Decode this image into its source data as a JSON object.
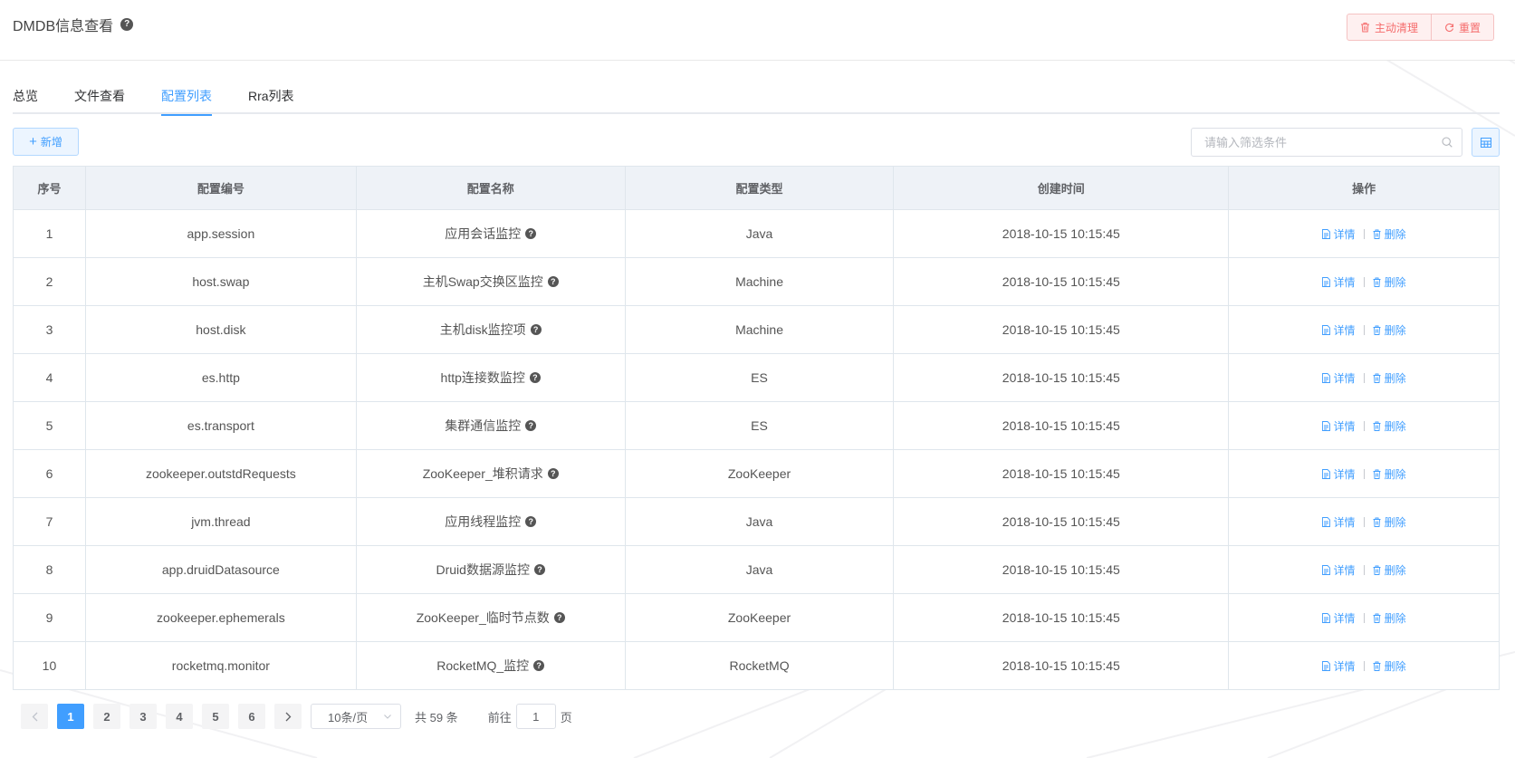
{
  "header": {
    "title": "DMDB信息查看",
    "clear_label": "主动清理",
    "reset_label": "重置"
  },
  "tabs": [
    {
      "label": "总览"
    },
    {
      "label": "文件查看"
    },
    {
      "label": "配置列表",
      "active": true
    },
    {
      "label": "Rra列表"
    }
  ],
  "toolbar": {
    "add_label": "新增",
    "search_placeholder": "请输入筛选条件"
  },
  "table": {
    "headers": [
      "序号",
      "配置编号",
      "配置名称",
      "配置类型",
      "创建时间",
      "操作"
    ],
    "rows": [
      {
        "idx": "1",
        "code": "app.session",
        "name": "应用会话监控",
        "type": "Java",
        "created": "2018-10-15 10:15:45"
      },
      {
        "idx": "2",
        "code": "host.swap",
        "name": "主机Swap交换区监控",
        "type": "Machine",
        "created": "2018-10-15 10:15:45"
      },
      {
        "idx": "3",
        "code": "host.disk",
        "name": "主机disk监控项",
        "type": "Machine",
        "created": "2018-10-15 10:15:45"
      },
      {
        "idx": "4",
        "code": "es.http",
        "name": "http连接数监控",
        "type": "ES",
        "created": "2018-10-15 10:15:45"
      },
      {
        "idx": "5",
        "code": "es.transport",
        "name": "集群通信监控",
        "type": "ES",
        "created": "2018-10-15 10:15:45"
      },
      {
        "idx": "6",
        "code": "zookeeper.outstdRequests",
        "name": "ZooKeeper_堆积请求",
        "type": "ZooKeeper",
        "created": "2018-10-15 10:15:45"
      },
      {
        "idx": "7",
        "code": "jvm.thread",
        "name": "应用线程监控",
        "type": "Java",
        "created": "2018-10-15 10:15:45"
      },
      {
        "idx": "8",
        "code": "app.druidDatasource",
        "name": "Druid数据源监控",
        "type": "Java",
        "created": "2018-10-15 10:15:45"
      },
      {
        "idx": "9",
        "code": "zookeeper.ephemerals",
        "name": "ZooKeeper_临时节点数",
        "type": "ZooKeeper",
        "created": "2018-10-15 10:15:45"
      },
      {
        "idx": "10",
        "code": "rocketmq.monitor",
        "name": "RocketMQ_监控",
        "type": "RocketMQ",
        "created": "2018-10-15 10:15:45"
      }
    ],
    "detail_label": "详情",
    "delete_label": "删除"
  },
  "pagination": {
    "pages": [
      "1",
      "2",
      "3",
      "4",
      "5",
      "6"
    ],
    "current": "1",
    "page_size": "10条/页",
    "total": "共 59 条",
    "goto_prefix": "前往",
    "goto_value": "1",
    "goto_suffix": "页"
  },
  "colors": {
    "accent": "#409eff",
    "danger": "#f56c6c"
  }
}
